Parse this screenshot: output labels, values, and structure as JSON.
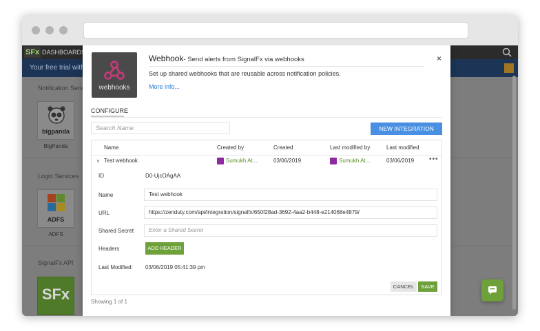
{
  "app": {
    "logo": "SFx",
    "nav_link": "DASHBOARDS",
    "trial_text": "Your free trial with ",
    "sections": [
      {
        "title": "Notification Servi",
        "tile": "BigPanda",
        "logo_text": "bigpanda"
      },
      {
        "title": "Login Services",
        "tile": "ADFS",
        "logo_text": "ADFS"
      },
      {
        "title": "SignalFx API",
        "logo_text": "SFx"
      }
    ]
  },
  "modal": {
    "icon_label": "webhooks",
    "title": "Webhook",
    "subtitle": "- Send alerts from SignalFx via webhooks",
    "description": "Set up shared webhooks that are reusable across notification policies.",
    "more_link": "More info...",
    "close": "×",
    "tab": "CONFIGURE",
    "search_placeholder": "Search Name",
    "new_integration": "NEW INTEGRATION",
    "columns": [
      "Name",
      "Created by",
      "Created",
      "Last modified by",
      "Last modified"
    ],
    "row": {
      "name": "Test webhook",
      "created_by": "Sumukh At...",
      "created": "03/06/2019",
      "last_modified_by": "Sumukh At...",
      "last_modified": "03/06/2019",
      "menu": "•••"
    },
    "details": {
      "id_label": "ID",
      "id_value": "D0-UjcOAgAA",
      "name_label": "Name",
      "name_value": "Test webhook",
      "url_label": "URL",
      "url_value": "https://zenduty.com/api/integration/signalfx/650f28ad-3692-4aa2-b448-e214068e4879/",
      "secret_label": "Shared Secret",
      "secret_placeholder": "Enter a Shared Secret",
      "headers_label": "Headers",
      "add_header": "ADD HEADER",
      "modified_label": "Last Modified:",
      "modified_value": "03/06/2019 05:41:39 pm"
    },
    "cancel": "CANCEL",
    "save": "SAVE",
    "showing": "Showing 1 of 1"
  },
  "colors": {
    "accent_blue": "#4a90e2",
    "accent_green": "#6fa13b",
    "nav_dark": "#2b2b2b",
    "trial_bar": "#1c3456"
  }
}
